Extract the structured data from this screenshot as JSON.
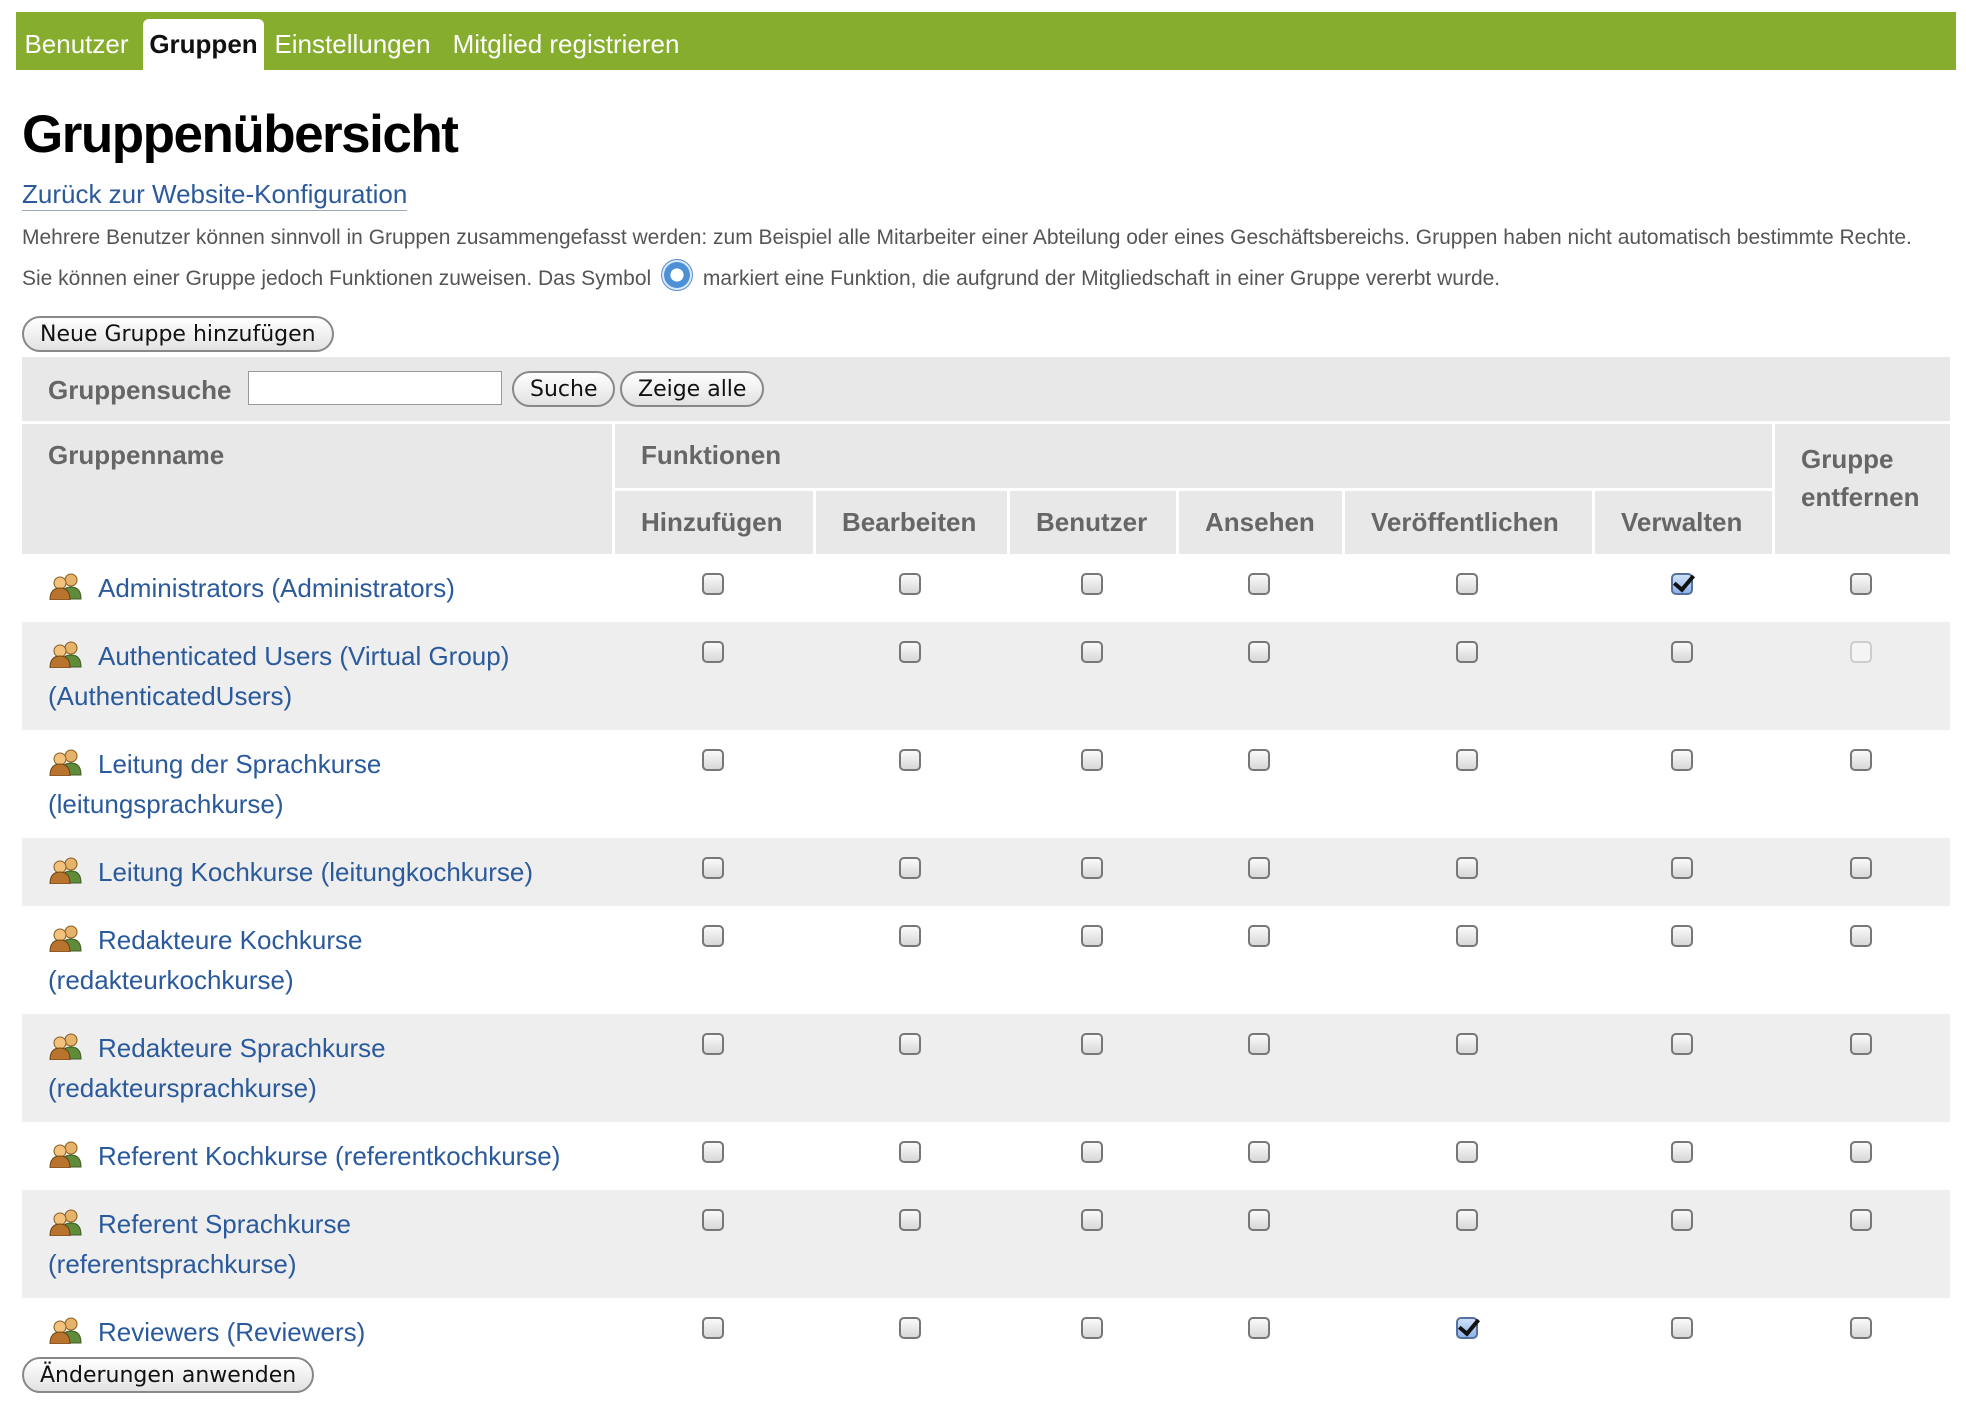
{
  "tabs": [
    {
      "label": "Benutzer",
      "active": false
    },
    {
      "label": "Gruppen",
      "active": true
    },
    {
      "label": "Einstellungen",
      "active": false
    },
    {
      "label": "Mitglied registrieren",
      "active": false
    }
  ],
  "page_title": "Gruppenübersicht",
  "back_link": "Zurück zur Website-Konfiguration",
  "description": {
    "before_symbol": "Mehrere Benutzer können sinnvoll in Gruppen zusammengefasst werden: zum Beispiel alle Mitarbeiter einer Abteilung oder eines Geschäftsbereichs. Gruppen haben nicht automatisch bestimmte Rechte. Sie können einer Gruppe jedoch Funktionen zuweisen. Das Symbol",
    "after_symbol": "markiert eine Funktion, die aufgrund der Mitgliedschaft in einer Gruppe vererbt wurde."
  },
  "add_group_button": "Neue Gruppe hinzufügen",
  "search": {
    "label": "Gruppensuche",
    "value": "",
    "search_button": "Suche",
    "show_all_button": "Zeige alle"
  },
  "table": {
    "header_group_name": "Gruppenname",
    "header_functions": "Funktionen",
    "header_remove": "Gruppe entfernen",
    "function_columns": [
      "Hinzufügen",
      "Bearbeiten",
      "Benutzer",
      "Ansehen",
      "Veröffentlichen",
      "Verwalten"
    ],
    "rows": [
      {
        "name": "Administrators (Administrators)",
        "functions": [
          false,
          false,
          false,
          false,
          false,
          true
        ],
        "remove": false,
        "remove_disabled": false
      },
      {
        "name": "Authenticated Users (Virtual Group) (AuthenticatedUsers)",
        "functions": [
          false,
          false,
          false,
          false,
          false,
          false
        ],
        "remove": false,
        "remove_disabled": true
      },
      {
        "name": "Leitung der Sprachkurse (leitungsprachkurse)",
        "functions": [
          false,
          false,
          false,
          false,
          false,
          false
        ],
        "remove": false,
        "remove_disabled": false
      },
      {
        "name": "Leitung Kochkurse (leitungkochkurse)",
        "functions": [
          false,
          false,
          false,
          false,
          false,
          false
        ],
        "remove": false,
        "remove_disabled": false
      },
      {
        "name": "Redakteure Kochkurse (redakteurkochkurse)",
        "functions": [
          false,
          false,
          false,
          false,
          false,
          false
        ],
        "remove": false,
        "remove_disabled": false
      },
      {
        "name": "Redakteure Sprachkurse (redakteursprachkurse)",
        "functions": [
          false,
          false,
          false,
          false,
          false,
          false
        ],
        "remove": false,
        "remove_disabled": false
      },
      {
        "name": "Referent Kochkurse (referentkochkurse)",
        "functions": [
          false,
          false,
          false,
          false,
          false,
          false
        ],
        "remove": false,
        "remove_disabled": false
      },
      {
        "name": "Referent Sprachkurse (referentsprachkurse)",
        "functions": [
          false,
          false,
          false,
          false,
          false,
          false
        ],
        "remove": false,
        "remove_disabled": false
      },
      {
        "name": "Reviewers (Reviewers)",
        "functions": [
          false,
          false,
          false,
          false,
          true,
          false
        ],
        "remove": false,
        "remove_disabled": false
      }
    ]
  },
  "apply_button": "Änderungen anwenden",
  "colors": {
    "tabbar": "#86ad2d",
    "link": "#2b5a9c",
    "header_bg": "#e8e8e8",
    "row_alt": "#eeeeee"
  },
  "icons": {
    "group": "group-users-icon",
    "inherited": "inherited-role-icon"
  }
}
